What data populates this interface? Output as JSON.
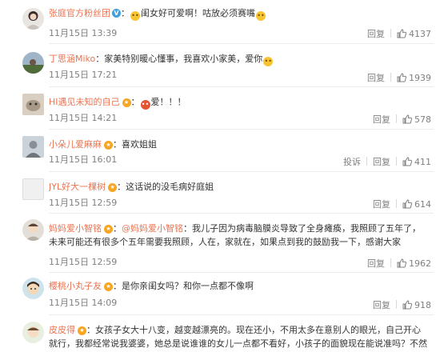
{
  "comments": [
    {
      "user": "张庭官方粉丝团",
      "verified": true,
      "emoji_before": "😱",
      "text": "闺女好可爱啊！咕放必须赛嘴",
      "emoji_after": "😋",
      "time": "11月15日 13:39",
      "reply_label": "回复",
      "likes": "4137"
    },
    {
      "user": "丁思涵Miko",
      "verified": false,
      "text": "家美特别暖心懂事，我喜欢小家美，爱你",
      "emoji_after": "😊",
      "time": "11月15日 17:21",
      "reply_label": "回复",
      "likes": "1939"
    },
    {
      "user": "HI遇见未知的自己",
      "level": true,
      "emoji_before": "😍",
      "text": "爱！！！",
      "time": "11月15日 14:21",
      "reply_label": "回复",
      "likes": "578"
    },
    {
      "user": "小朵儿爱麻麻",
      "level": true,
      "text": "喜欢姐姐",
      "time": "11月15日 16:01",
      "reply_label": "投诉",
      "reply2_label": "回复",
      "likes": "411"
    },
    {
      "user": "JYL好大一棵树",
      "level": true,
      "text": "这话说的没毛病好庭姐",
      "time": "11月15日 12:59",
      "reply_label": "回复",
      "likes": "614"
    },
    {
      "user": "妈妈爱小智铭",
      "level": true,
      "mention": "@妈妈爱小智铭",
      "text": "我儿子因为病毒脑膜炎导致了全身瘫痪，我照顾了五年了，",
      "text2": "未来可能还有很多个五年需要我照顾，人在，家就在，如果点到我的鼓励我一下，感谢大家",
      "time": "11月15日 12:59",
      "reply_label": "回复",
      "likes": "1962"
    },
    {
      "user": "樱桃小丸子友",
      "level": true,
      "text": "是你亲闺女吗？和你一点都不像啊",
      "time": "11月15日 14:09",
      "reply_label": "回复",
      "likes": "918"
    },
    {
      "user": "皮皮得",
      "level": true,
      "text": "女孩子女大十八变，越变越漂亮的。现在还小，不用太多在意别人的眼光，自己开心",
      "text2": "就行，我都经常说我婆婆，她总是说谁谁的女儿一点都不看好，小孩子的面貌现在能说准吗？不然"
    }
  ],
  "colors": {
    "username": "#eb7350",
    "meta": "#808080",
    "text": "#333333",
    "divider": "#ececec"
  }
}
